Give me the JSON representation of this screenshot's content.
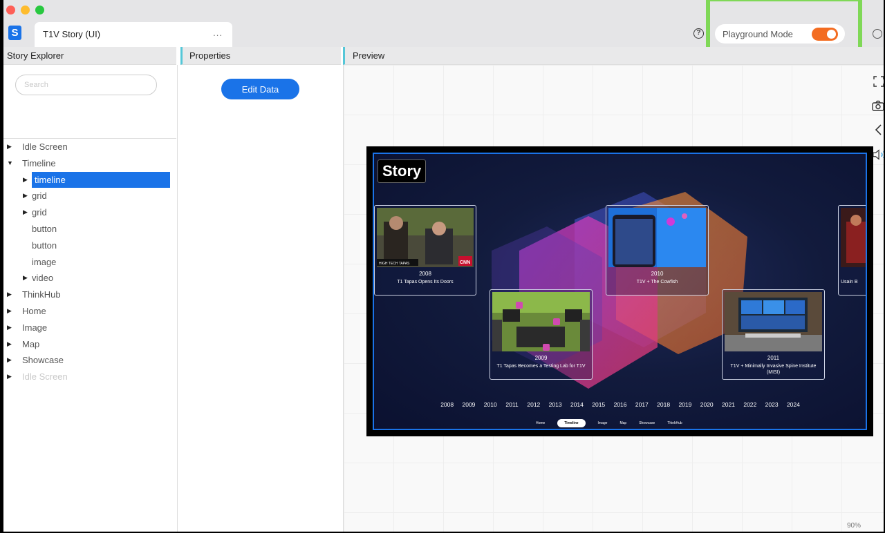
{
  "window": {
    "tab_title": "T1V Story (UI)",
    "tab_menu": "...",
    "help_icon": "?",
    "playground_label": "Playground Mode",
    "playground_on": true,
    "accent": "#f36c21",
    "highlight_color": "#7fd857"
  },
  "panels": {
    "explorer_title": "Story Explorer",
    "properties_title": "Properties",
    "preview_title": "Preview"
  },
  "explorer": {
    "search_placeholder": "Search",
    "items": [
      {
        "label": "Idle Screen",
        "arrow": "▶",
        "level": 0
      },
      {
        "label": "Timeline",
        "arrow": "▼",
        "level": 0
      },
      {
        "label": "timeline",
        "arrow": "▶",
        "level": 1,
        "selected": true
      },
      {
        "label": "grid",
        "arrow": "▶",
        "level": 1
      },
      {
        "label": "grid",
        "arrow": "▶",
        "level": 1
      },
      {
        "label": "button",
        "arrow": "",
        "level": 1
      },
      {
        "label": "button",
        "arrow": "",
        "level": 1
      },
      {
        "label": "image",
        "arrow": "",
        "level": 1
      },
      {
        "label": "video",
        "arrow": "▶",
        "level": 1
      },
      {
        "label": "ThinkHub",
        "arrow": "▶",
        "level": 0
      },
      {
        "label": "Home",
        "arrow": "▶",
        "level": 0
      },
      {
        "label": "Image",
        "arrow": "▶",
        "level": 0
      },
      {
        "label": "Map",
        "arrow": "▶",
        "level": 0
      },
      {
        "label": "Showcase",
        "arrow": "▶",
        "level": 0
      },
      {
        "label": "Idle Screen",
        "arrow": "▶",
        "level": 0,
        "disabled": true
      }
    ]
  },
  "properties": {
    "edit_data_label": "Edit Data"
  },
  "preview": {
    "zoom": "90%",
    "tools": [
      "fullscreen-icon",
      "camera-icon",
      "back-icon",
      "speaker-icon"
    ],
    "story": {
      "logo": "Story",
      "cards": [
        {
          "year": "2008",
          "title": "T1 Tapas Opens Its Doors",
          "photo_caption": "HIGH TECH TAPAS",
          "photo_badge": "CNN"
        },
        {
          "year": "2009",
          "title": "T1 Tapas Becomes a Testing Lab for T1V"
        },
        {
          "year": "2010",
          "title": "T1V + The Cowfish"
        },
        {
          "year": "2011",
          "title": "T1V + Minimally Invasive Spine Institute (MISI)"
        },
        {
          "year": "",
          "title": "Usain B"
        }
      ],
      "years": [
        "2008",
        "2009",
        "2010",
        "2011",
        "2012",
        "2013",
        "2014",
        "2015",
        "2016",
        "2017",
        "2018",
        "2019",
        "2020",
        "2021",
        "2022",
        "2023",
        "2024"
      ],
      "nav": [
        "Home",
        "Timeline",
        "Image",
        "Map",
        "Showcase",
        "ThinkHub"
      ],
      "nav_active": "Timeline"
    }
  }
}
